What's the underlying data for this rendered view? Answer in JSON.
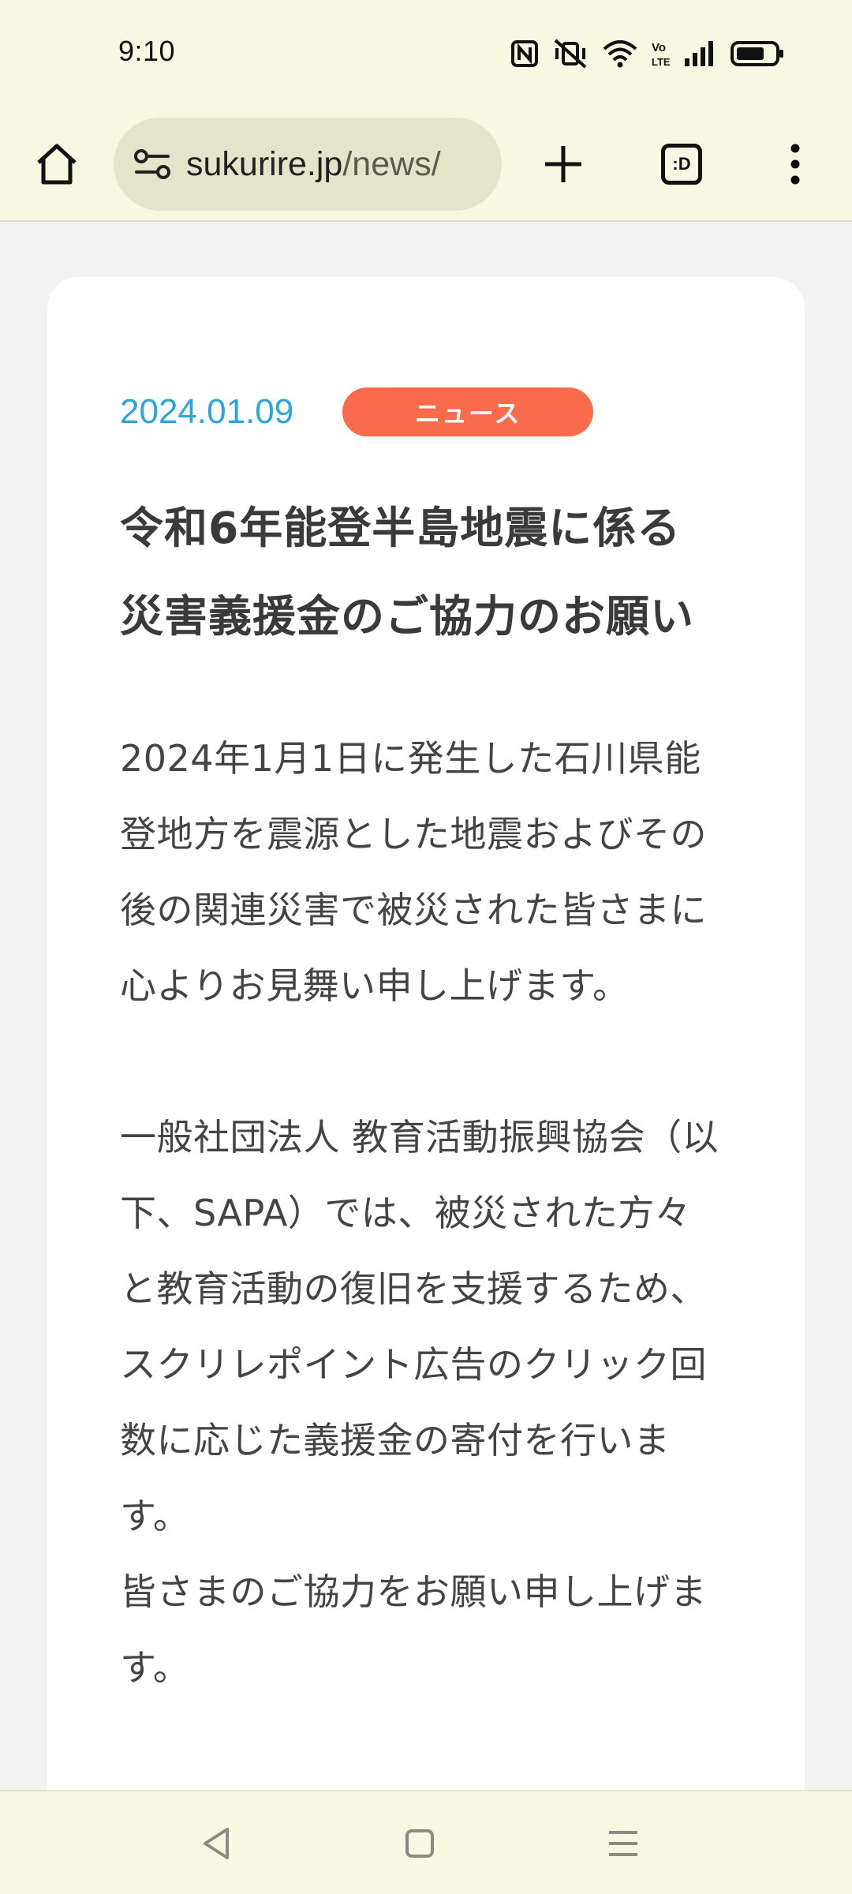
{
  "status_bar": {
    "time": "9:10",
    "icons": [
      "nfc-icon",
      "vibrate-off-icon",
      "wifi-icon",
      "volte-icon",
      "signal-icon",
      "battery-icon"
    ]
  },
  "browser": {
    "url_host": "sukurire.jp",
    "url_path": "/news/",
    "tab_switcher_label": ":D",
    "icons": [
      "home-icon",
      "site-settings-icon",
      "plus-icon",
      "more-vert-icon"
    ]
  },
  "article": {
    "date": "2024.01.09",
    "category": "ニュース",
    "title_lines": [
      "令和6年能登半島地震に係る",
      "災害義援金のご協力のお願い"
    ],
    "para1_lines": [
      "2024年1月1日に発生した石川県能",
      "登地方を震源とした地震およびその",
      "後の関連災害で被災された皆さまに",
      "心よりお見舞い申し上げます。"
    ],
    "para2_lines": [
      "一般社団法人 教育活動振興協会（以",
      "下、SAPA）では、被災された方々",
      "と教育活動の復旧を支援するため、",
      "スクリレポイント広告のクリック回",
      "数に応じた義援金の寄付を行いま",
      "す。",
      "皆さまのご協力をお願い申し上げま",
      "す。"
    ]
  },
  "colors": {
    "chrome_bg": "#f7f8e2",
    "omnibox_bg": "#e3e5cb",
    "page_bg": "#f2f2f2",
    "date": "#2aa6df",
    "badge": "#f96b4a"
  },
  "nav_bar": {
    "icons": [
      "back-icon",
      "home-square-icon",
      "recents-icon"
    ]
  }
}
